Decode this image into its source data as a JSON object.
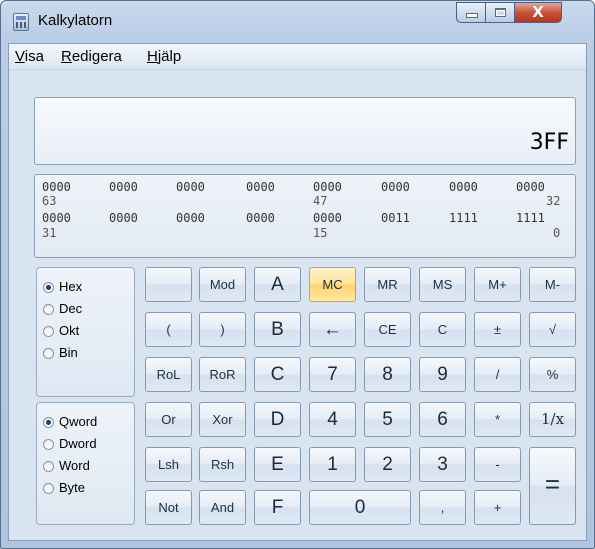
{
  "window": {
    "title": "Kalkylatorn",
    "close_glyph": "X"
  },
  "menu": [
    {
      "first": "V",
      "rest": "isa"
    },
    {
      "first": "R",
      "rest": "edigera"
    },
    {
      "first": "H",
      "rest": "jälp"
    }
  ],
  "display": {
    "value": "3FF"
  },
  "bits": {
    "row1": [
      "0000",
      "0000",
      "0000",
      "0000",
      "0000",
      "0000",
      "0000",
      "0000"
    ],
    "row1_positions": [
      "63",
      "47",
      "32"
    ],
    "row2": [
      "0000",
      "0000",
      "0000",
      "0000",
      "0000",
      "0011",
      "1111",
      "1111"
    ],
    "row2_positions": [
      "31",
      "15",
      "0"
    ]
  },
  "base_options": [
    "Hex",
    "Dec",
    "Okt",
    "Bin"
  ],
  "base_selected": "Hex",
  "word_options": [
    "Qword",
    "Dword",
    "Word",
    "Byte"
  ],
  "word_selected": "Qword",
  "buttons": {
    "blank": "",
    "mod": "Mod",
    "a": "A",
    "mc": "MC",
    "mr": "MR",
    "ms": "MS",
    "mplus": "M+",
    "mminus": "M-",
    "lparen": "(",
    "rparen": ")",
    "b": "B",
    "backspace": "←",
    "ce": "CE",
    "c": "C",
    "plusminus": "±",
    "sqrt": "√",
    "rol": "RoL",
    "ror": "RoR",
    "hc": "C",
    "n7": "7",
    "n8": "8",
    "n9": "9",
    "divide": "/",
    "percent": "%",
    "or": "Or",
    "xor": "Xor",
    "d": "D",
    "n4": "4",
    "n5": "5",
    "n6": "6",
    "multiply": "*",
    "reciprocal": "1/x",
    "lsh": "Lsh",
    "rsh": "Rsh",
    "e": "E",
    "n1": "1",
    "n2": "2",
    "n3": "3",
    "minus": "-",
    "equals": "=",
    "not": "Not",
    "and": "And",
    "f": "F",
    "n0": "0",
    "comma": ",",
    "plus": "+"
  }
}
